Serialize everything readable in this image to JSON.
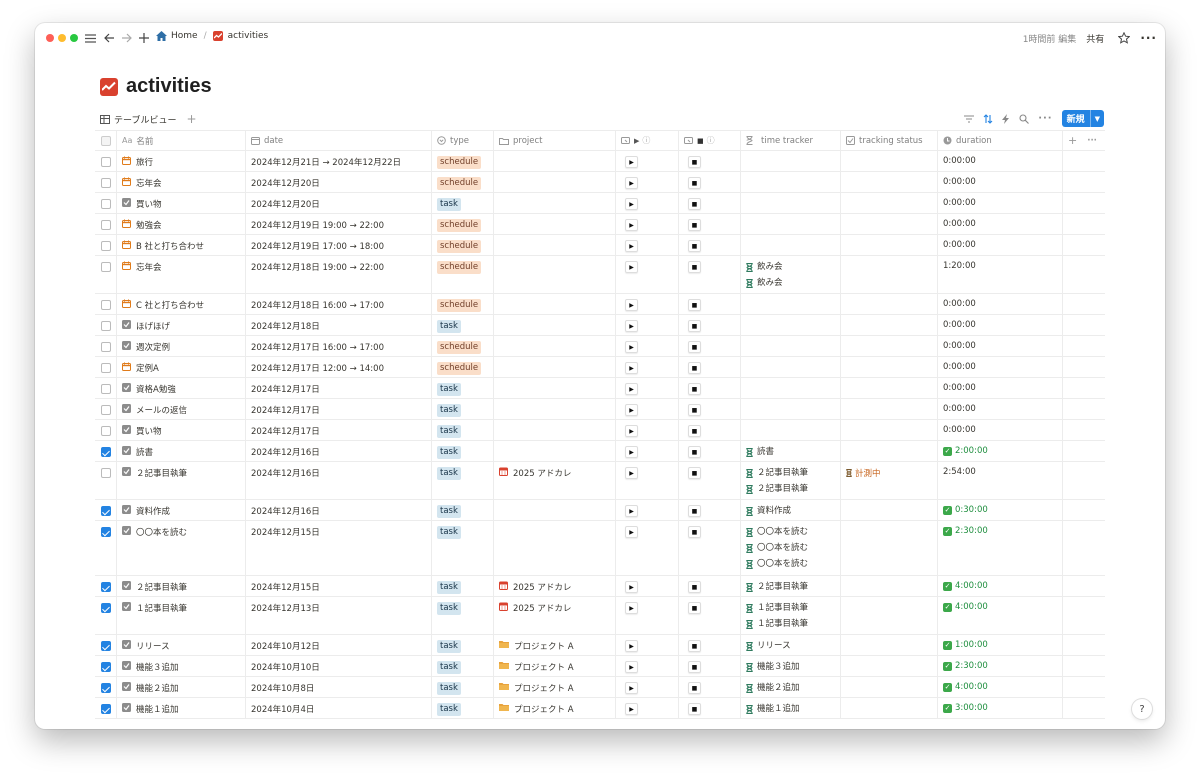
{
  "topbar": {
    "breadcrumb_home": "Home",
    "breadcrumb_page": "activities",
    "last_edited": "1時間前 編集",
    "share": "共有"
  },
  "page": {
    "title": "activities"
  },
  "view": {
    "tab_label": "テーブルビュー",
    "new_button": "新規"
  },
  "columns": {
    "name": "名前",
    "date": "date",
    "type": "type",
    "project": "project",
    "time_tracker": "time tracker",
    "tracking_status": "tracking status",
    "duration": "duration"
  },
  "icons": {
    "schedule": "calendar-icon",
    "task": "checkbox-icon",
    "timer": "hourglass-icon",
    "project_adkale": "calendar-icon",
    "project_a": "folder-icon"
  },
  "colors": {
    "accent": "#2383e2",
    "schedule_tag_bg": "#fadec9",
    "task_tag_bg": "#d3e5ef",
    "done_green": "#1e8e3e",
    "status_orange": "#c7641d"
  },
  "rows": [
    {
      "checked": false,
      "kind": "schedule",
      "name": "旅行",
      "date": "2024年12月21日 → 2024年12月22日",
      "type": "schedule",
      "project": "",
      "trackers": [],
      "status": "",
      "duration": "0:00:00",
      "done": false
    },
    {
      "checked": false,
      "kind": "schedule",
      "name": "忘年会",
      "date": "2024年12月20日",
      "type": "schedule",
      "project": "",
      "trackers": [],
      "status": "",
      "duration": "0:00:00",
      "done": false
    },
    {
      "checked": false,
      "kind": "task",
      "name": "買い物",
      "date": "2024年12月20日",
      "type": "task",
      "project": "",
      "trackers": [],
      "status": "",
      "duration": "0:00:00",
      "done": false
    },
    {
      "checked": false,
      "kind": "schedule",
      "name": "勉強会",
      "date": "2024年12月19日 19:00 → 22:00",
      "type": "schedule",
      "project": "",
      "trackers": [],
      "status": "",
      "duration": "0:00:00",
      "done": false
    },
    {
      "checked": false,
      "kind": "schedule",
      "name": "B 社と打ち合わせ",
      "date": "2024年12月19日 17:00 → 18:00",
      "type": "schedule",
      "project": "",
      "trackers": [],
      "status": "",
      "duration": "0:00:00",
      "done": false
    },
    {
      "checked": false,
      "kind": "schedule",
      "name": "忘年会",
      "date": "2024年12月18日 19:00 → 22:00",
      "type": "schedule",
      "project": "",
      "trackers": [
        "飲み会",
        "飲み会"
      ],
      "status": "",
      "duration": "1:20:00",
      "done": false
    },
    {
      "checked": false,
      "kind": "schedule",
      "name": "C 社と打ち合わせ",
      "date": "2024年12月18日 16:00 → 17:00",
      "type": "schedule",
      "project": "",
      "trackers": [],
      "status": "",
      "duration": "0:00:00",
      "done": false
    },
    {
      "checked": false,
      "kind": "task",
      "name": "ほげほげ",
      "date": "2024年12月18日",
      "type": "task",
      "project": "",
      "trackers": [],
      "status": "",
      "duration": "0:00:00",
      "done": false
    },
    {
      "checked": false,
      "kind": "task",
      "name": "週次定例",
      "date": "2024年12月17日 16:00 → 17:00",
      "type": "schedule",
      "project": "",
      "trackers": [],
      "status": "",
      "duration": "0:00:00",
      "done": false
    },
    {
      "checked": false,
      "kind": "schedule",
      "name": "定例A",
      "date": "2024年12月17日 12:00 → 14:00",
      "type": "schedule",
      "project": "",
      "trackers": [],
      "status": "",
      "duration": "0:00:00",
      "done": false
    },
    {
      "checked": false,
      "kind": "task",
      "name": "資格A勉強",
      "date": "2024年12月17日",
      "type": "task",
      "project": "",
      "trackers": [],
      "status": "",
      "duration": "0:00:00",
      "done": false
    },
    {
      "checked": false,
      "kind": "task",
      "name": "メールの返信",
      "date": "2024年12月17日",
      "type": "task",
      "project": "",
      "trackers": [],
      "status": "",
      "duration": "0:00:00",
      "done": false
    },
    {
      "checked": false,
      "kind": "task",
      "name": "買い物",
      "date": "2024年12月17日",
      "type": "task",
      "project": "",
      "trackers": [],
      "status": "",
      "duration": "0:00:00",
      "done": false
    },
    {
      "checked": true,
      "kind": "task",
      "name": "読書",
      "date": "2024年12月16日",
      "type": "task",
      "project": "",
      "trackers": [
        "読書"
      ],
      "status": "",
      "duration": "2:00:00",
      "done": true
    },
    {
      "checked": false,
      "kind": "task",
      "name": "２記事目執筆",
      "date": "2024年12月16日",
      "type": "task",
      "project": "2025 アドカレ",
      "projectIcon": "cal",
      "trackers": [
        "２記事目執筆",
        "２記事目執筆"
      ],
      "status": "計測中",
      "duration": "2:54:00",
      "done": false
    },
    {
      "checked": true,
      "kind": "task",
      "name": "資料作成",
      "date": "2024年12月16日",
      "type": "task",
      "project": "",
      "trackers": [
        "資料作成"
      ],
      "status": "",
      "duration": "0:30:00",
      "done": true
    },
    {
      "checked": true,
      "kind": "task",
      "name": "〇〇本を読む",
      "date": "2024年12月15日",
      "type": "task",
      "project": "",
      "trackers": [
        "〇〇本を読む",
        "〇〇本を読む",
        "〇〇本を読む"
      ],
      "status": "",
      "duration": "2:30:00",
      "done": true
    },
    {
      "checked": true,
      "kind": "task",
      "name": "２記事目執筆",
      "date": "2024年12月15日",
      "type": "task",
      "project": "2025 アドカレ",
      "projectIcon": "cal",
      "trackers": [
        "２記事目執筆"
      ],
      "status": "",
      "duration": "4:00:00",
      "done": true
    },
    {
      "checked": true,
      "kind": "task",
      "name": "１記事目執筆",
      "date": "2024年12月13日",
      "type": "task",
      "project": "2025 アドカレ",
      "projectIcon": "cal",
      "trackers": [
        "１記事目執筆",
        "１記事目執筆"
      ],
      "status": "",
      "duration": "4:00:00",
      "done": true
    },
    {
      "checked": true,
      "kind": "task",
      "name": "リリース",
      "date": "2024年10月12日",
      "type": "task",
      "project": "プロジェクト A",
      "projectIcon": "folder",
      "trackers": [
        "リリース"
      ],
      "status": "",
      "duration": "1:00:00",
      "done": true
    },
    {
      "checked": true,
      "kind": "task",
      "name": "機能３追加",
      "date": "2024年10月10日",
      "type": "task",
      "project": "プロジェクト A",
      "projectIcon": "folder",
      "trackers": [
        "機能３追加"
      ],
      "status": "",
      "duration": "2:30:00",
      "done": true
    },
    {
      "checked": true,
      "kind": "task",
      "name": "機能２追加",
      "date": "2024年10月8日",
      "type": "task",
      "project": "プロジェクト A",
      "projectIcon": "folder",
      "trackers": [
        "機能２追加"
      ],
      "status": "",
      "duration": "4:00:00",
      "done": true
    },
    {
      "checked": true,
      "kind": "task",
      "name": "機能１追加",
      "date": "2024年10月4日",
      "type": "task",
      "project": "プロジェクト A",
      "projectIcon": "folder",
      "trackers": [
        "機能１追加"
      ],
      "status": "",
      "duration": "3:00:00",
      "done": true
    }
  ]
}
